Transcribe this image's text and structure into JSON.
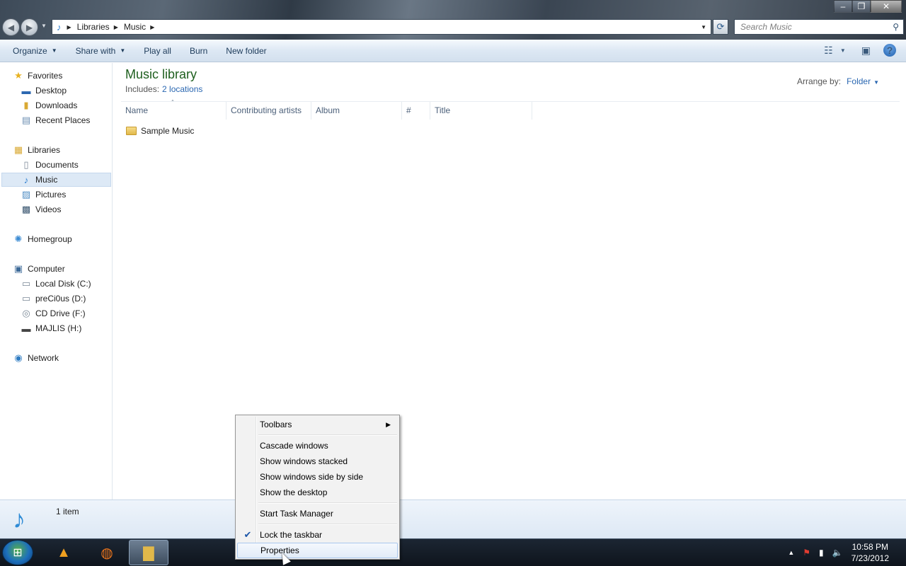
{
  "address": {
    "crumbs": [
      "Libraries",
      "Music"
    ],
    "search_placeholder": "Search Music"
  },
  "toolbar": {
    "organize": "Organize",
    "share_with": "Share with",
    "play_all": "Play all",
    "burn": "Burn",
    "new_folder": "New folder"
  },
  "nav": {
    "favorites": "Favorites",
    "desktop": "Desktop",
    "downloads": "Downloads",
    "recent": "Recent Places",
    "libraries": "Libraries",
    "documents": "Documents",
    "music": "Music",
    "pictures": "Pictures",
    "videos": "Videos",
    "homegroup": "Homegroup",
    "computer": "Computer",
    "local_disk": "Local Disk (C:)",
    "drive_d": "preCi0us (D:)",
    "cd_drive": "CD Drive (F:)",
    "drive_h": "MAJLIS (H:)",
    "network": "Network"
  },
  "content": {
    "title": "Music library",
    "includes_label": "Includes:",
    "includes_link": "2 locations",
    "arrange_label": "Arrange by:",
    "arrange_value": "Folder",
    "columns": {
      "name": "Name",
      "artists": "Contributing artists",
      "album": "Album",
      "number": "#",
      "title": "Title"
    },
    "items": [
      "Sample Music"
    ]
  },
  "details": {
    "count": "1 item"
  },
  "context_menu": {
    "toolbars": "Toolbars",
    "cascade": "Cascade windows",
    "stacked": "Show windows stacked",
    "side_by_side": "Show windows side by side",
    "show_desktop": "Show the desktop",
    "task_manager": "Start Task Manager",
    "lock_taskbar": "Lock the taskbar",
    "properties": "Properties"
  },
  "clock": {
    "time": "10:58 PM",
    "date": "7/23/2012"
  },
  "icons": {
    "start": "windows-start-icon",
    "vlc": "vlc-icon",
    "firefox": "firefox-icon",
    "explorer": "explorer-icon"
  }
}
